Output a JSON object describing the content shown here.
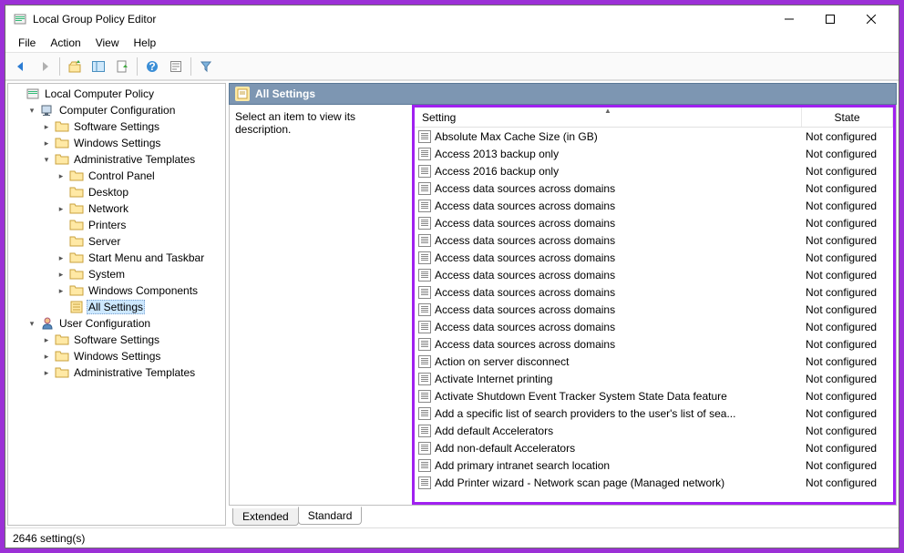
{
  "window": {
    "title": "Local Group Policy Editor"
  },
  "menubar": [
    "File",
    "Action",
    "View",
    "Help"
  ],
  "content_header": "All Settings",
  "description_prompt": "Select an item to view its description.",
  "columns": {
    "setting": "Setting",
    "state": "State"
  },
  "tabs": {
    "extended": "Extended",
    "standard": "Standard"
  },
  "statusbar": "2646 setting(s)",
  "tree": {
    "root": "Local Computer Policy",
    "comp": "Computer Configuration",
    "comp_soft": "Software Settings",
    "comp_win": "Windows Settings",
    "comp_admin": "Administrative Templates",
    "ctrlpanel": "Control Panel",
    "desktop": "Desktop",
    "network": "Network",
    "printers": "Printers",
    "server": "Server",
    "startmenu": "Start Menu and Taskbar",
    "system": "System",
    "wincomp": "Windows Components",
    "allsettings": "All Settings",
    "user": "User Configuration",
    "user_soft": "Software Settings",
    "user_win": "Windows Settings",
    "user_admin": "Administrative Templates"
  },
  "settings": [
    {
      "name": "Absolute Max Cache Size (in GB)",
      "state": "Not configured"
    },
    {
      "name": "Access 2013 backup only",
      "state": "Not configured"
    },
    {
      "name": "Access 2016 backup only",
      "state": "Not configured"
    },
    {
      "name": "Access data sources across domains",
      "state": "Not configured"
    },
    {
      "name": "Access data sources across domains",
      "state": "Not configured"
    },
    {
      "name": "Access data sources across domains",
      "state": "Not configured"
    },
    {
      "name": "Access data sources across domains",
      "state": "Not configured"
    },
    {
      "name": "Access data sources across domains",
      "state": "Not configured"
    },
    {
      "name": "Access data sources across domains",
      "state": "Not configured"
    },
    {
      "name": "Access data sources across domains",
      "state": "Not configured"
    },
    {
      "name": "Access data sources across domains",
      "state": "Not configured"
    },
    {
      "name": "Access data sources across domains",
      "state": "Not configured"
    },
    {
      "name": "Access data sources across domains",
      "state": "Not configured"
    },
    {
      "name": "Action on server disconnect",
      "state": "Not configured"
    },
    {
      "name": "Activate Internet printing",
      "state": "Not configured"
    },
    {
      "name": "Activate Shutdown Event Tracker System State Data feature",
      "state": "Not configured"
    },
    {
      "name": "Add a specific list of search providers to the user's list of sea...",
      "state": "Not configured"
    },
    {
      "name": "Add default Accelerators",
      "state": "Not configured"
    },
    {
      "name": "Add non-default Accelerators",
      "state": "Not configured"
    },
    {
      "name": "Add primary intranet search location",
      "state": "Not configured"
    },
    {
      "name": "Add Printer wizard - Network scan page (Managed network)",
      "state": "Not configured"
    }
  ]
}
